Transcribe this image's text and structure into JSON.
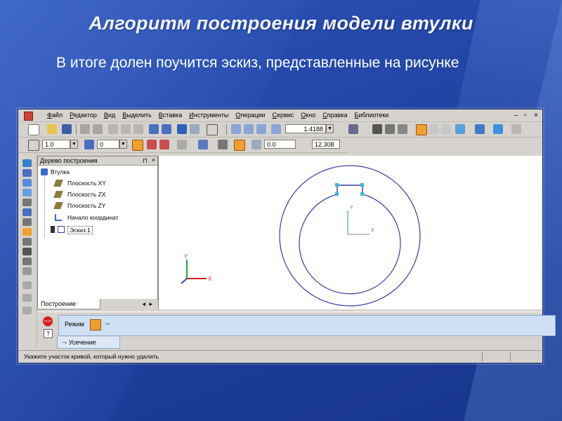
{
  "slide": {
    "title": "Алгоритм построения модели втулки",
    "subtitle": "В итоге долен поучится эскиз, представленные на рисунке"
  },
  "app": {
    "menu": [
      "Файл",
      "Редактор",
      "Вид",
      "Выделить",
      "Вставка",
      "Инструменты",
      "Операции",
      "Сервис",
      "Окно",
      "Справка",
      "Библиотеки"
    ],
    "toolbar1": {
      "zoom_value": "1.4188"
    },
    "toolbar2": {
      "step_value": "1.0",
      "layer_value": "0",
      "x_value": "0.0",
      "y_value": "12.308"
    },
    "tree": {
      "header": "Дерево построения",
      "root": "Втулка",
      "items": [
        "Плоскость XY",
        "Плоскость ZX",
        "Плоскость ZY",
        "Начало координат",
        "Эскиз:1"
      ],
      "tab": "Построение"
    },
    "canvas": {
      "axis_x": "X",
      "axis_y": "Y"
    },
    "properties": {
      "mode_label": "Режим",
      "tab": "Усечение",
      "stop_label": "STOP"
    },
    "status": "Укажите участок кривой, который нужно удалить"
  },
  "colors": {
    "accent": "#2c54b8",
    "sketch_line": "#3a3aa8",
    "highlight": "#3ab5d8"
  }
}
